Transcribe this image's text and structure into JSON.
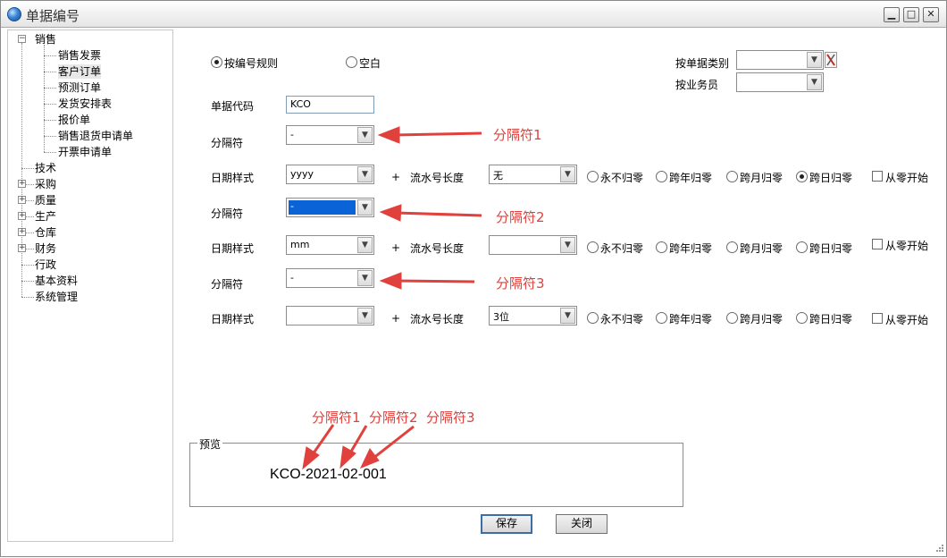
{
  "window": {
    "title": "单据编号",
    "minimize_icon": "minimize-icon",
    "maximize_icon": "maximize-icon",
    "close_icon": "close-icon"
  },
  "tree": {
    "items": [
      {
        "label": "销售",
        "expander": "−"
      },
      {
        "label": "销售发票"
      },
      {
        "label": "客户订单"
      },
      {
        "label": "预测订单"
      },
      {
        "label": "发货安排表"
      },
      {
        "label": "报价单"
      },
      {
        "label": "销售退货申请单"
      },
      {
        "label": "开票申请单"
      },
      {
        "label": "技术"
      },
      {
        "label": "采购",
        "expander": "+"
      },
      {
        "label": "质量",
        "expander": "+"
      },
      {
        "label": "生产",
        "expander": "+"
      },
      {
        "label": "仓库",
        "expander": "+"
      },
      {
        "label": "财务",
        "expander": "+"
      },
      {
        "label": "行政"
      },
      {
        "label": "基本资料"
      },
      {
        "label": "系统管理"
      }
    ]
  },
  "form": {
    "mode_by_rule": "按编号规则",
    "mode_blank": "空白",
    "bill_category_label": "按单据类别",
    "salesperson_label": "按业务员",
    "doc_code_label": "单据代码",
    "doc_code_value": "KCO",
    "separator_label": "分隔符",
    "date_style_label": "日期样式",
    "plus": "+",
    "serial_len_label": "流水号长度",
    "reset_never": "永不归零",
    "reset_year": "跨年归零",
    "reset_month": "跨月归零",
    "reset_day": "跨日归零",
    "from_zero": "从零开始",
    "rows": [
      {
        "separator": "-",
        "date_style": "yyyy",
        "serial_len": "无",
        "reset": "day"
      },
      {
        "separator": "-",
        "date_style": "mm",
        "serial_len": "",
        "reset": ""
      },
      {
        "separator": "-",
        "date_style": "",
        "serial_len": "3位",
        "reset": ""
      }
    ],
    "preview_label": "预览",
    "preview_value": "KCO-2021-02-001",
    "save_button": "保存",
    "close_button": "关闭"
  },
  "annotations": {
    "sep1": "分隔符1",
    "sep2": "分隔符2",
    "sep3": "分隔符3",
    "accent": "#e0413d"
  }
}
